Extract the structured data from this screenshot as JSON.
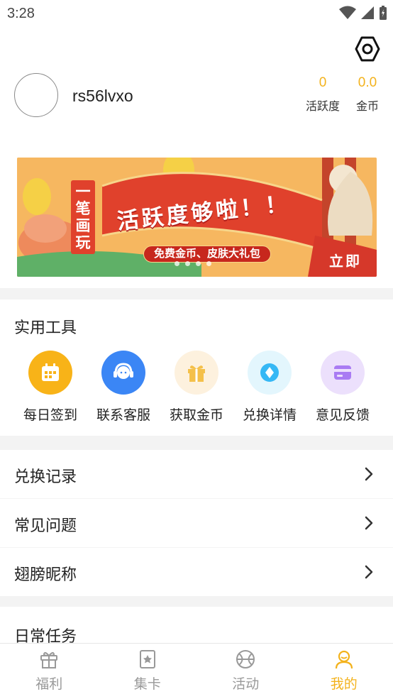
{
  "status_bar": {
    "time": "3:28"
  },
  "profile": {
    "username": "rs56lvxo",
    "stats": [
      {
        "value": "0",
        "label": "活跃度"
      },
      {
        "value": "0.0",
        "label": "金币"
      }
    ]
  },
  "banner": {
    "vertical_text": "一笔画玩",
    "headline": "活跃度够啦！！",
    "pill": "免费金币、皮肤大礼包",
    "cta": "立即",
    "slide_count": 4
  },
  "tools": {
    "title": "实用工具",
    "items": [
      {
        "label": "每日签到",
        "icon": "calendar-icon",
        "color": "#f8b318"
      },
      {
        "label": "联系客服",
        "icon": "headset-icon",
        "color": "#3b86f5"
      },
      {
        "label": "获取金币",
        "icon": "gift-icon",
        "color": "#f4c04a"
      },
      {
        "label": "兑换详情",
        "icon": "diamond-icon",
        "color": "#36b8f5"
      },
      {
        "label": "意见反馈",
        "icon": "card-icon",
        "color": "#a97bf3"
      }
    ]
  },
  "menu": [
    {
      "label": "兑换记录"
    },
    {
      "label": "常见问题"
    },
    {
      "label": "翅膀昵称"
    }
  ],
  "daily": {
    "title": "日常任务"
  },
  "nav": [
    {
      "label": "福利",
      "icon": "gift-icon",
      "active": false
    },
    {
      "label": "集卡",
      "icon": "card-collect-icon",
      "active": false
    },
    {
      "label": "活动",
      "icon": "basketball-icon",
      "active": false
    },
    {
      "label": "我的",
      "icon": "profile-icon",
      "active": true
    }
  ],
  "colors": {
    "accent": "#f3b21c",
    "inactive": "#999999"
  }
}
